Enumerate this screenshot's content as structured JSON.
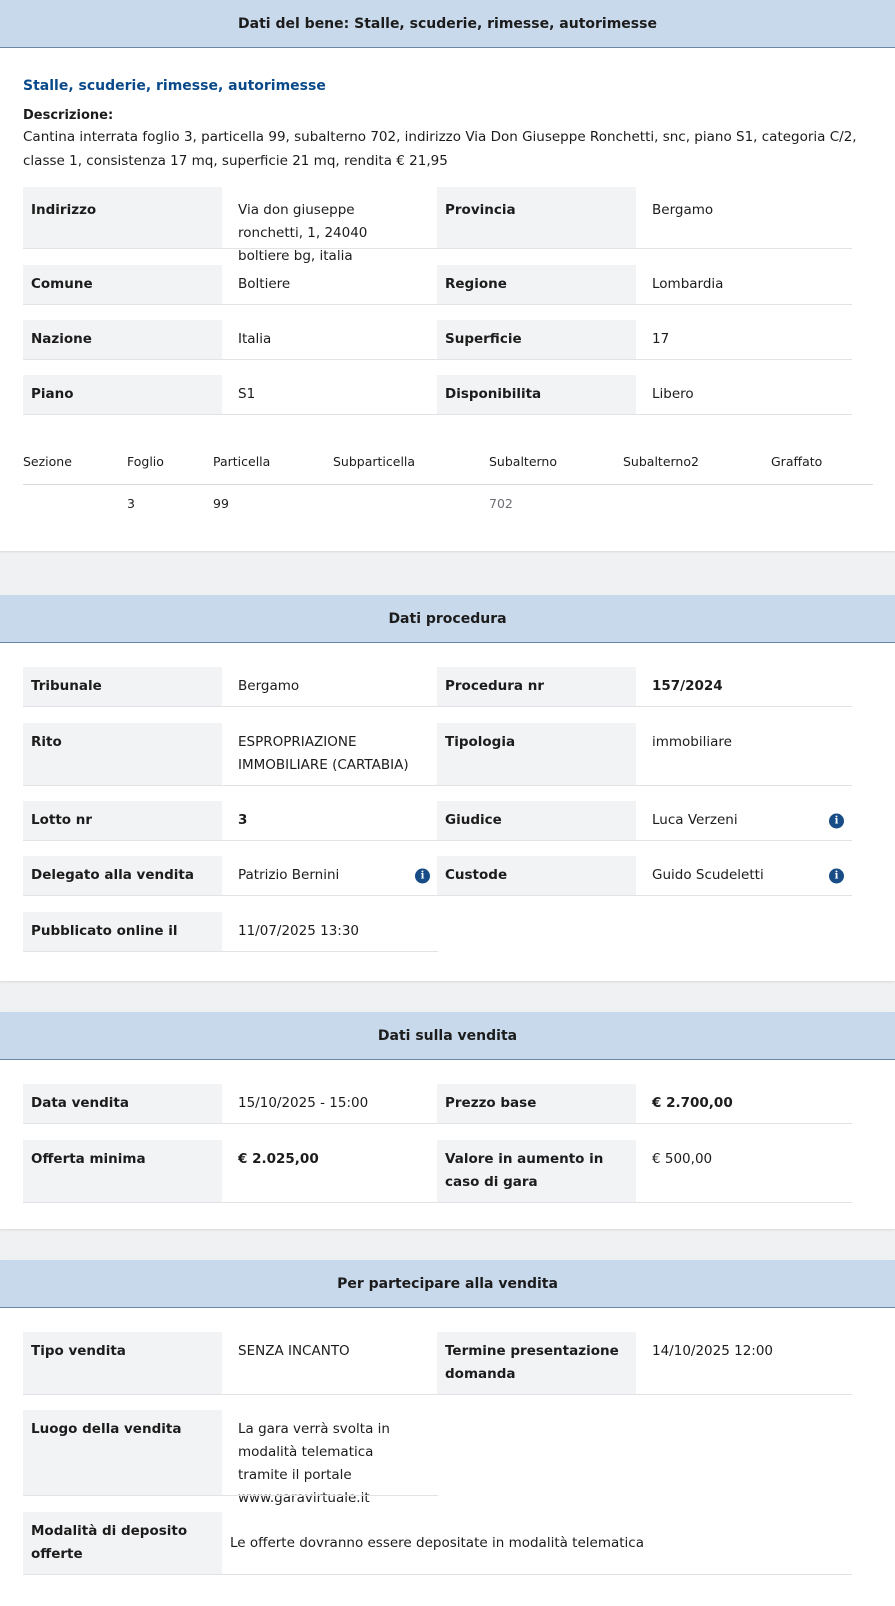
{
  "bene": {
    "header": "Dati del bene: Stalle, scuderie, rimesse, autorimesse",
    "category_title": "Stalle, scuderie, rimesse, autorimesse",
    "descrizione_label": "Descrizione:",
    "descrizione_text": "Cantina interrata foglio 3, particella 99, subalterno 702, indirizzo Via Don Giuseppe Ronchetti, snc, piano S1, categoria C/2, classe 1, consistenza 17 mq, superficie 21 mq, rendita € 21,95",
    "fields": {
      "indirizzo": {
        "label": "Indirizzo",
        "value": "Via don giuseppe ronchetti, 1, 24040 boltiere bg, italia"
      },
      "provincia": {
        "label": "Provincia",
        "value": "Bergamo"
      },
      "comune": {
        "label": "Comune",
        "value": "Boltiere"
      },
      "regione": {
        "label": "Regione",
        "value": "Lombardia"
      },
      "nazione": {
        "label": "Nazione",
        "value": "Italia"
      },
      "superficie": {
        "label": "Superficie",
        "value": "17"
      },
      "piano": {
        "label": "Piano",
        "value": "S1"
      },
      "disponibilita": {
        "label": "Disponibilita",
        "value": "Libero"
      }
    },
    "catasto": {
      "headers": [
        "Sezione",
        "Foglio",
        "Particella",
        "Subparticella",
        "Subalterno",
        "Subalterno2",
        "Graffato"
      ],
      "row": [
        "",
        "3",
        "99",
        "",
        "702",
        "",
        ""
      ]
    }
  },
  "procedura": {
    "header": "Dati procedura",
    "fields": {
      "tribunale": {
        "label": "Tribunale",
        "value": "Bergamo"
      },
      "procedura_nr": {
        "label": "Procedura nr",
        "value": "157/2024"
      },
      "rito": {
        "label": "Rito",
        "value": "ESPROPRIAZIONE IMMOBILIARE (CARTABIA)"
      },
      "tipologia": {
        "label": "Tipologia",
        "value": "immobiliare"
      },
      "lotto_nr": {
        "label": "Lotto nr",
        "value": "3"
      },
      "giudice": {
        "label": "Giudice",
        "value": "Luca Verzeni"
      },
      "delegato": {
        "label": "Delegato alla vendita",
        "value": "Patrizio Bernini"
      },
      "custode": {
        "label": "Custode",
        "value": "Guido Scudeletti"
      },
      "pubblicato": {
        "label": "Pubblicato online il",
        "value": "11/07/2025 13:30"
      }
    },
    "info_icon": "info-circle-icon"
  },
  "vendita": {
    "header": "Dati sulla vendita",
    "fields": {
      "data_vendita": {
        "label": "Data vendita",
        "value": "15/10/2025 - 15:00"
      },
      "prezzo_base": {
        "label": "Prezzo base",
        "value": "€ 2.700,00"
      },
      "offerta_minima": {
        "label": "Offerta minima",
        "value": "€ 2.025,00"
      },
      "valore_aumento": {
        "label": "Valore in aumento in caso di gara",
        "value": "€ 500,00"
      }
    }
  },
  "partecipare": {
    "header": "Per partecipare alla vendita",
    "fields": {
      "tipo_vendita": {
        "label": "Tipo vendita",
        "value": "SENZA INCANTO"
      },
      "termine": {
        "label": "Termine presentazione domanda",
        "value": "14/10/2025 12:00"
      },
      "luogo": {
        "label": "Luogo della vendita",
        "value": "La gara verrà svolta in modalità telematica tramite il portale www.garavirtuale.it"
      },
      "modalita": {
        "label": "Modalità di deposito offerte",
        "value": "Le offerte dovranno essere depositate in modalità telematica"
      }
    }
  },
  "colors": {
    "header_bg": "#c9d9ec",
    "label_bg": "#f2f3f5",
    "link_blue": "#0a4a8a",
    "info_icon": "#174c86"
  }
}
